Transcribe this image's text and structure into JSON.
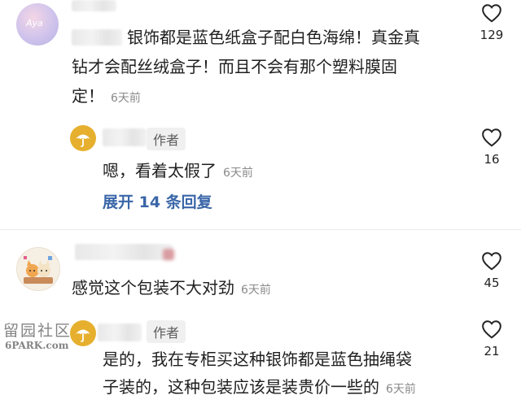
{
  "comments": [
    {
      "text_lines": [
        "银饰都是蓝色纸盒子配白色海绵！真金真",
        "钻才会配丝绒盒子！而且不会有那个塑料膜固",
        "定！"
      ],
      "time": "6天前",
      "likes": "129"
    },
    {
      "author_tag": "作者",
      "text": "嗯，看着太假了",
      "time": "6天前",
      "likes": "16",
      "expand_label": "展开 14 条回复"
    },
    {
      "text": "感觉这个包装不大对劲",
      "time": "6天前",
      "likes": "45"
    },
    {
      "author_tag": "作者",
      "text_lines": [
        "是的，我在专柜买这种银饰都是蓝色抽绳袋",
        "子装的，这种包装应该是装贵价一些的"
      ],
      "time": "6天前",
      "likes": "21"
    }
  ],
  "watermark": {
    "line1": "留园社区",
    "line2": "6PARK.com"
  },
  "colors": {
    "expand_link": "#3a66a8",
    "umbrella_avatar": "#e6b02e"
  },
  "icons": {
    "like": "heart-outline-icon",
    "author_avatar": "umbrella-icon"
  }
}
